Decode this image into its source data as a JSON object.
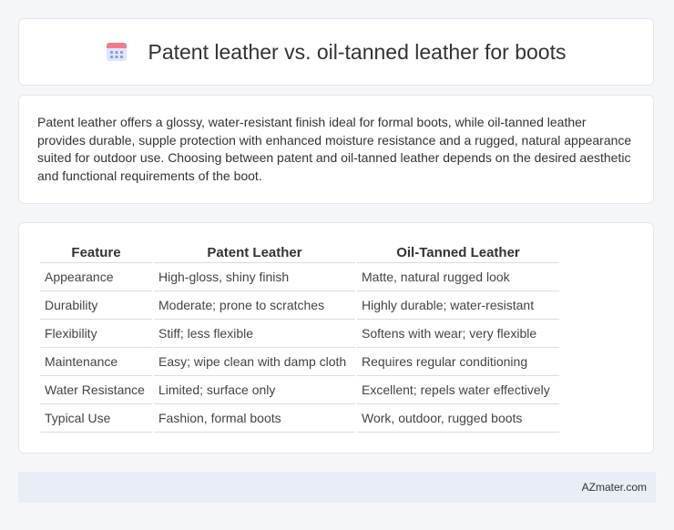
{
  "header": {
    "title": "Patent leather vs. oil-tanned leather for boots",
    "icon": "calendar-icon",
    "icon_colors": {
      "top": "#f47a8a",
      "body": "#dfe6fb",
      "dots": "#8a9ce8"
    }
  },
  "summary": {
    "text": "Patent leather offers a glossy, water-resistant finish ideal for formal boots, while oil-tanned leather provides durable, supple protection with enhanced moisture resistance and a rugged, natural appearance suited for outdoor use. Choosing between patent and oil-tanned leather depends on the desired aesthetic and functional requirements of the boot."
  },
  "table": {
    "headers": [
      "Feature",
      "Patent Leather",
      "Oil-Tanned Leather"
    ],
    "rows": [
      [
        "Appearance",
        "High-gloss, shiny finish",
        "Matte, natural rugged look"
      ],
      [
        "Durability",
        "Moderate; prone to scratches",
        "Highly durable; water-resistant"
      ],
      [
        "Flexibility",
        "Stiff; less flexible",
        "Softens with wear; very flexible"
      ],
      [
        "Maintenance",
        "Easy; wipe clean with damp cloth",
        "Requires regular conditioning"
      ],
      [
        "Water Resistance",
        "Limited; surface only",
        "Excellent; repels water effectively"
      ],
      [
        "Typical Use",
        "Fashion, formal boots",
        "Work, outdoor, rugged boots"
      ]
    ]
  },
  "footer": {
    "brand": "AZmater.com"
  }
}
